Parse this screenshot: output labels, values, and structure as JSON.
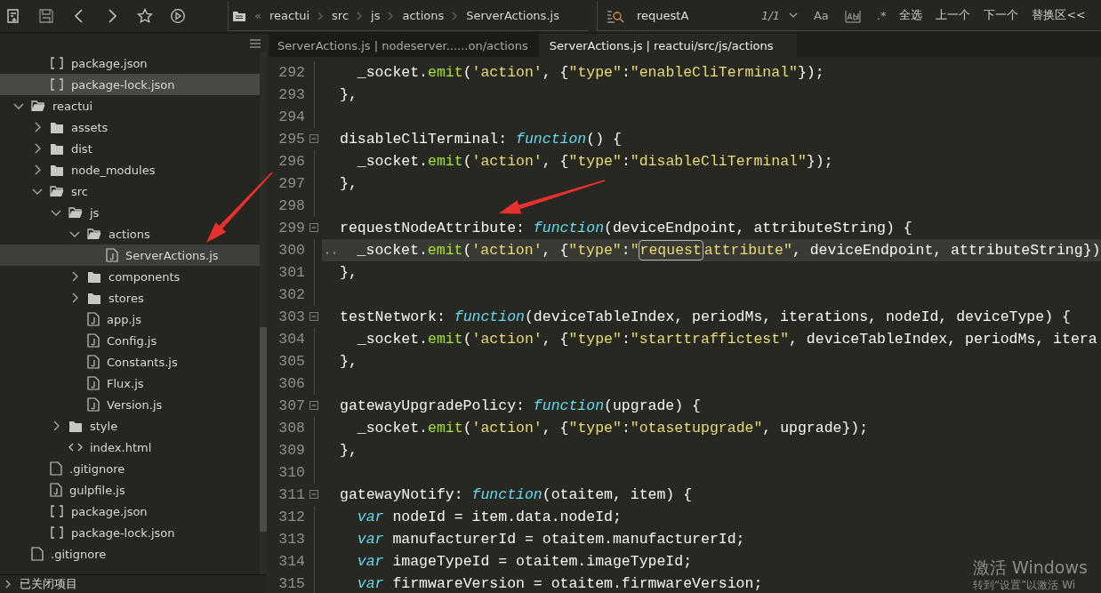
{
  "toolbar": {
    "breadcrumb": {
      "overflow": "«",
      "items": [
        "reactui",
        "src",
        "js",
        "actions",
        "ServerActions.js"
      ]
    },
    "search": {
      "value": "requestA",
      "count": "1/1",
      "case_label": "Aa",
      "regex_label": ".*",
      "buttons": [
        "全选",
        "上一个",
        "下一个",
        "替换区<<"
      ]
    }
  },
  "sidebar": {
    "partial_children": [
      {
        "label": "package.json",
        "kind": "json",
        "selected": false
      },
      {
        "label": "package-lock.json",
        "kind": "json",
        "selected": true
      }
    ],
    "items": [
      {
        "label": "reactui",
        "kind": "folder",
        "expanded": true,
        "selected": false,
        "children": [
          {
            "label": "assets",
            "kind": "folder",
            "expanded": false,
            "selected": false
          },
          {
            "label": "dist",
            "kind": "folder",
            "expanded": false,
            "selected": false
          },
          {
            "label": "node_modules",
            "kind": "folder",
            "expanded": false,
            "selected": false
          },
          {
            "label": "src",
            "kind": "folder",
            "expanded": true,
            "selected": false,
            "children": [
              {
                "label": "js",
                "kind": "folder",
                "expanded": true,
                "selected": false,
                "children": [
                  {
                    "label": "actions",
                    "kind": "folder",
                    "expanded": true,
                    "selected": false,
                    "children": [
                      {
                        "label": "ServerActions.js",
                        "kind": "js",
                        "selected": true
                      }
                    ]
                  },
                  {
                    "label": "components",
                    "kind": "folder",
                    "expanded": false,
                    "selected": false
                  },
                  {
                    "label": "stores",
                    "kind": "folder",
                    "expanded": false,
                    "selected": false
                  },
                  {
                    "label": "app.js",
                    "kind": "js",
                    "selected": false
                  },
                  {
                    "label": "Config.js",
                    "kind": "js",
                    "selected": false
                  },
                  {
                    "label": "Constants.js",
                    "kind": "js",
                    "selected": false
                  },
                  {
                    "label": "Flux.js",
                    "kind": "js",
                    "selected": false
                  },
                  {
                    "label": "Version.js",
                    "kind": "js",
                    "selected": false
                  }
                ]
              },
              {
                "label": "style",
                "kind": "folder",
                "expanded": false,
                "selected": false
              },
              {
                "label": "index.html",
                "kind": "html",
                "selected": false
              }
            ]
          },
          {
            "label": ".gitignore",
            "kind": "file",
            "selected": false
          },
          {
            "label": "gulpfile.js",
            "kind": "js",
            "selected": false
          },
          {
            "label": "package.json",
            "kind": "json",
            "selected": false
          },
          {
            "label": "package-lock.json",
            "kind": "json",
            "selected": false
          }
        ]
      },
      {
        "label": ".gitignore",
        "kind": "file",
        "selected": false
      }
    ],
    "closed_projects": {
      "label": "已关闭项目",
      "expanded": false
    }
  },
  "tabs": [
    {
      "label": "ServerActions.js | nodeserver......on/actions",
      "selected": false
    },
    {
      "label": "ServerActions.js | reactui/src/js/actions",
      "selected": true
    }
  ],
  "editor": {
    "lines": [
      {
        "number": "292",
        "foldable": false,
        "current": false,
        "tokens": [
          {
            "kind": "plain",
            "text": "  _socket."
          },
          {
            "kind": "method",
            "text": "emit"
          },
          {
            "kind": "plain",
            "text": "("
          },
          {
            "kind": "str",
            "text": "'action'"
          },
          {
            "kind": "plain",
            "text": ", {"
          },
          {
            "kind": "str",
            "text": "\"type\""
          },
          {
            "kind": "plain",
            "text": ":"
          },
          {
            "kind": "str",
            "text": "\"enableCliTerminal\""
          },
          {
            "kind": "plain",
            "text": "});"
          }
        ]
      },
      {
        "number": "293",
        "foldable": false,
        "current": false,
        "tokens": [
          {
            "kind": "plain",
            "text": "},"
          }
        ]
      },
      {
        "number": "294",
        "foldable": false,
        "current": false
      },
      {
        "number": "295",
        "foldable": true,
        "current": false,
        "tokens": [
          {
            "kind": "plain",
            "text": "disableCliTerminal: "
          },
          {
            "kind": "kw",
            "text": "function"
          },
          {
            "kind": "plain",
            "text": "() {"
          }
        ]
      },
      {
        "number": "296",
        "foldable": false,
        "current": false,
        "tokens": [
          {
            "kind": "plain",
            "text": "  _socket."
          },
          {
            "kind": "method",
            "text": "emit"
          },
          {
            "kind": "plain",
            "text": "("
          },
          {
            "kind": "str",
            "text": "'action'"
          },
          {
            "kind": "plain",
            "text": ", {"
          },
          {
            "kind": "str",
            "text": "\"type\""
          },
          {
            "kind": "plain",
            "text": ":"
          },
          {
            "kind": "str",
            "text": "\"disableCliTerminal\""
          },
          {
            "kind": "plain",
            "text": "});"
          }
        ]
      },
      {
        "number": "297",
        "foldable": false,
        "current": false,
        "tokens": [
          {
            "kind": "plain",
            "text": "},"
          }
        ]
      },
      {
        "number": "298",
        "foldable": false,
        "current": false
      },
      {
        "number": "299",
        "foldable": true,
        "current": false,
        "tokens": [
          {
            "kind": "plain",
            "text": "requestNodeAttribute: "
          },
          {
            "kind": "kw",
            "text": "function"
          },
          {
            "kind": "plain",
            "text": "(deviceEndpoint, attributeString) {"
          }
        ]
      },
      {
        "number": "300",
        "foldable": false,
        "current": true,
        "tokens": [
          {
            "kind": "plain",
            "text": "  _socket."
          },
          {
            "kind": "method",
            "text": "emit"
          },
          {
            "kind": "plain",
            "text": "("
          },
          {
            "kind": "str",
            "text": "'action'"
          },
          {
            "kind": "plain",
            "text": ", {"
          },
          {
            "kind": "str",
            "text": "\"type\""
          },
          {
            "kind": "plain",
            "text": ":"
          },
          {
            "kind": "str",
            "text": "\""
          },
          {
            "kind": "match",
            "text": "request"
          },
          {
            "kind": "str",
            "text": "attribute\""
          },
          {
            "kind": "plain",
            "text": ", deviceEndpoint, attributeString})"
          }
        ]
      },
      {
        "number": "301",
        "foldable": false,
        "current": false,
        "tokens": [
          {
            "kind": "plain",
            "text": "},"
          }
        ]
      },
      {
        "number": "302",
        "foldable": false,
        "current": false
      },
      {
        "number": "303",
        "foldable": true,
        "current": false,
        "tokens": [
          {
            "kind": "plain",
            "text": "testNetwork: "
          },
          {
            "kind": "kw",
            "text": "function"
          },
          {
            "kind": "plain",
            "text": "(deviceTableIndex, periodMs, iterations, nodeId, deviceType) {"
          }
        ]
      },
      {
        "number": "304",
        "foldable": false,
        "current": false,
        "tokens": [
          {
            "kind": "plain",
            "text": "  _socket."
          },
          {
            "kind": "method",
            "text": "emit"
          },
          {
            "kind": "plain",
            "text": "("
          },
          {
            "kind": "str",
            "text": "'action'"
          },
          {
            "kind": "plain",
            "text": ", {"
          },
          {
            "kind": "str",
            "text": "\"type\""
          },
          {
            "kind": "plain",
            "text": ":"
          },
          {
            "kind": "str",
            "text": "\"starttraffictest\""
          },
          {
            "kind": "plain",
            "text": ", deviceTableIndex, periodMs, itera"
          }
        ]
      },
      {
        "number": "305",
        "foldable": false,
        "current": false,
        "tokens": [
          {
            "kind": "plain",
            "text": "},"
          }
        ]
      },
      {
        "number": "306",
        "foldable": false,
        "current": false
      },
      {
        "number": "307",
        "foldable": true,
        "current": false,
        "tokens": [
          {
            "kind": "plain",
            "text": "gatewayUpgradePolicy: "
          },
          {
            "kind": "kw",
            "text": "function"
          },
          {
            "kind": "plain",
            "text": "(upgrade) {"
          }
        ]
      },
      {
        "number": "308",
        "foldable": false,
        "current": false,
        "tokens": [
          {
            "kind": "plain",
            "text": "  _socket."
          },
          {
            "kind": "method",
            "text": "emit"
          },
          {
            "kind": "plain",
            "text": "("
          },
          {
            "kind": "str",
            "text": "'action'"
          },
          {
            "kind": "plain",
            "text": ", {"
          },
          {
            "kind": "str",
            "text": "\"type\""
          },
          {
            "kind": "plain",
            "text": ":"
          },
          {
            "kind": "str",
            "text": "\"otasetupgrade\""
          },
          {
            "kind": "plain",
            "text": ", upgrade});"
          }
        ]
      },
      {
        "number": "309",
        "foldable": false,
        "current": false,
        "tokens": [
          {
            "kind": "plain",
            "text": "},"
          }
        ]
      },
      {
        "number": "310",
        "foldable": false,
        "current": false
      },
      {
        "number": "311",
        "foldable": true,
        "current": false,
        "tokens": [
          {
            "kind": "plain",
            "text": "gatewayNotify: "
          },
          {
            "kind": "kw",
            "text": "function"
          },
          {
            "kind": "plain",
            "text": "(otaitem, item) {"
          }
        ]
      },
      {
        "number": "312",
        "foldable": false,
        "current": false,
        "tokens": [
          {
            "kind": "kw",
            "text": "  var"
          },
          {
            "kind": "plain",
            "text": " nodeId = item.data.nodeId;"
          }
        ]
      },
      {
        "number": "313",
        "foldable": false,
        "current": false,
        "tokens": [
          {
            "kind": "kw",
            "text": "  var"
          },
          {
            "kind": "plain",
            "text": " manufacturerId = otaitem.manufacturerId;"
          }
        ]
      },
      {
        "number": "314",
        "foldable": false,
        "current": false,
        "tokens": [
          {
            "kind": "kw",
            "text": "  var"
          },
          {
            "kind": "plain",
            "text": " imageTypeId = otaitem.imageTypeId;"
          }
        ]
      },
      {
        "number": "315",
        "foldable": false,
        "current": false,
        "tokens": [
          {
            "kind": "kw",
            "text": "  var"
          },
          {
            "kind": "plain",
            "text": " firmwareVersion = otaitem.firmwareVersion;"
          }
        ]
      }
    ]
  },
  "activation_notice": {
    "title": "激活 Windows",
    "hint": "转到“设置”以激活 Wi"
  }
}
